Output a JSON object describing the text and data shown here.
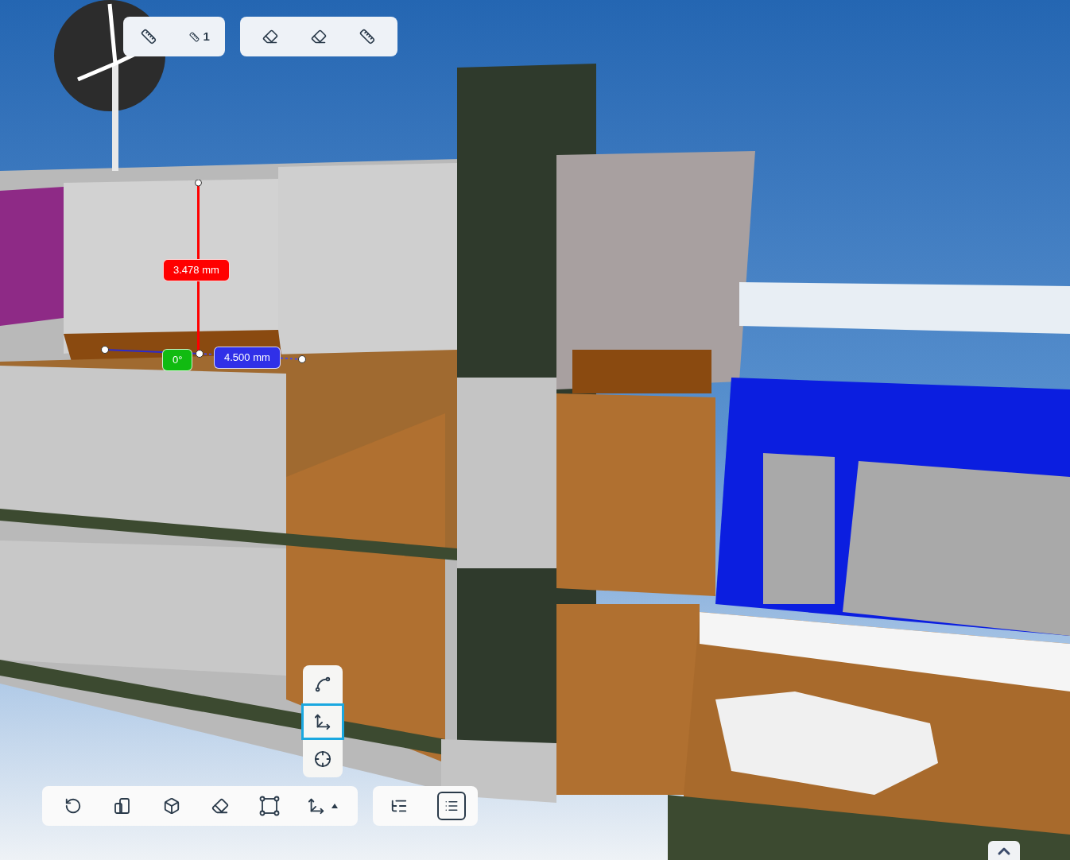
{
  "measure_toolbar": {
    "count": "1"
  },
  "measurements": [
    {
      "text": "3.478 mm",
      "color": "#ff0000"
    },
    {
      "text": "0°",
      "color": "#11bb11"
    },
    {
      "text": "4.500 mm",
      "color": "#3030e8"
    }
  ],
  "measure_mode_menu": {
    "items": [
      {
        "selected": false
      },
      {
        "selected": true
      },
      {
        "selected": false
      }
    ]
  }
}
